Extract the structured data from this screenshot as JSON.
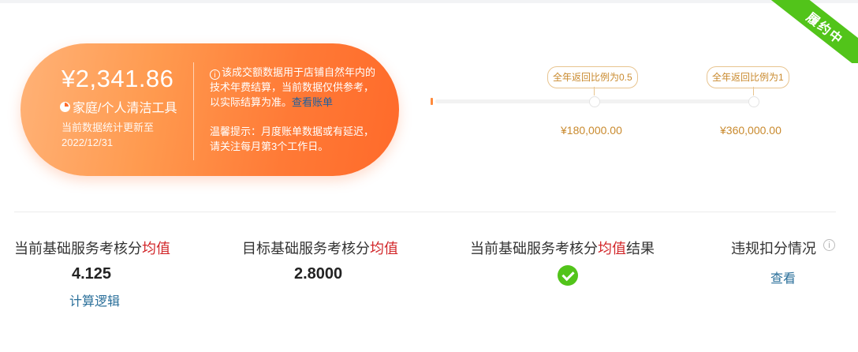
{
  "status_ribbon": "履约中",
  "summary_card": {
    "amount": "¥2,341.86",
    "category": "家庭/个人清洁工具",
    "stat_note": "当前数据统计更新至2022/12/31",
    "notice_text": "该成交额数据用于店铺自然年内的技术年费结算，当前数据仅供参考，以实际结算为准。",
    "notice_link": "查看账单",
    "tip_text": "温馨提示：月度账单数据或有延迟，请关注每月第3个工作日。"
  },
  "milestones": [
    {
      "label": "全年返回比例为0.5",
      "amount": "¥180,000.00"
    },
    {
      "label": "全年返回比例为1",
      "amount": "¥360,000.00"
    }
  ],
  "metrics": {
    "current_avg": {
      "title_prefix": "当前基础服务考核分",
      "title_highlight": "均值",
      "value": "4.125",
      "link": "计算逻辑"
    },
    "target_avg": {
      "title_prefix": "目标基础服务考核分",
      "title_highlight": "均值",
      "value": "2.8000"
    },
    "result": {
      "title_prefix": "当前基础服务考核分",
      "title_highlight": "均值",
      "title_suffix": "结果",
      "icon": "check-circle-icon"
    },
    "violation": {
      "title": "违规扣分情况",
      "link": "查看"
    }
  },
  "colors": {
    "accent_orange": "#ff7a36",
    "ribbon_green": "#52c41a",
    "highlight_red": "#d2272a",
    "link_blue": "#2a6f9a",
    "milestone_gold": "#c98a2e"
  }
}
